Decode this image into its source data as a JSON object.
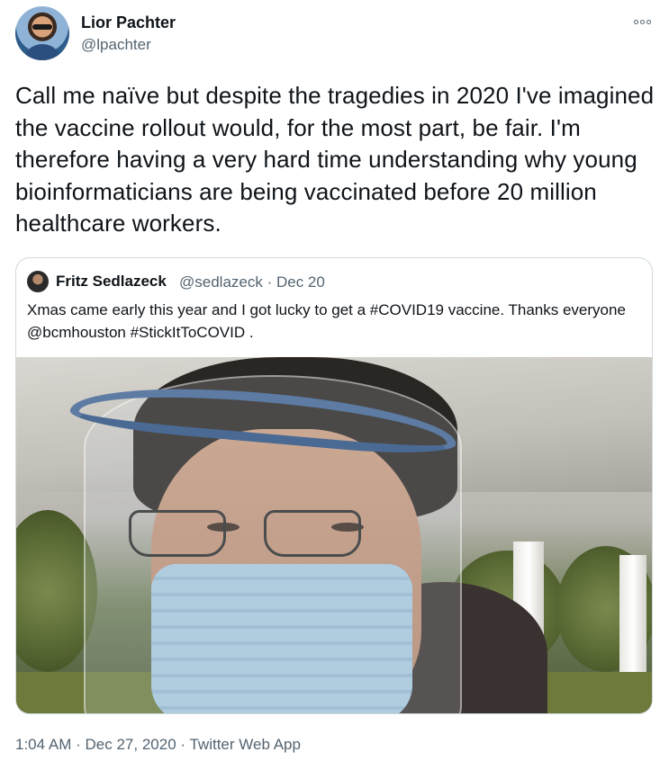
{
  "author": {
    "name": "Lior Pachter",
    "handle": "@lpachter"
  },
  "tweet": {
    "text": "Call me naïve but despite the tragedies in 2020 I've imagined the vaccine rollout would, for the most part, be fair. I'm therefore having a very hard time understanding why young bioinformaticians are being vaccinated before 20 million healthcare workers."
  },
  "quoted": {
    "name": "Fritz Sedlazeck",
    "handle_date": "@sedlazeck · Dec 20",
    "text": "Xmas came early this year and I got lucky to get a #COVID19 vaccine. Thanks everyone @bcmhouston  #StickItToCOVID ."
  },
  "meta": {
    "time": "1:04 AM",
    "date": "Dec 27, 2020",
    "app": "Twitter Web App",
    "separator": "·"
  },
  "icons": {
    "more": "more-options-icon"
  },
  "colors": {
    "text": "#0f1419",
    "secondary": "#536471",
    "border": "#cfd9de"
  }
}
